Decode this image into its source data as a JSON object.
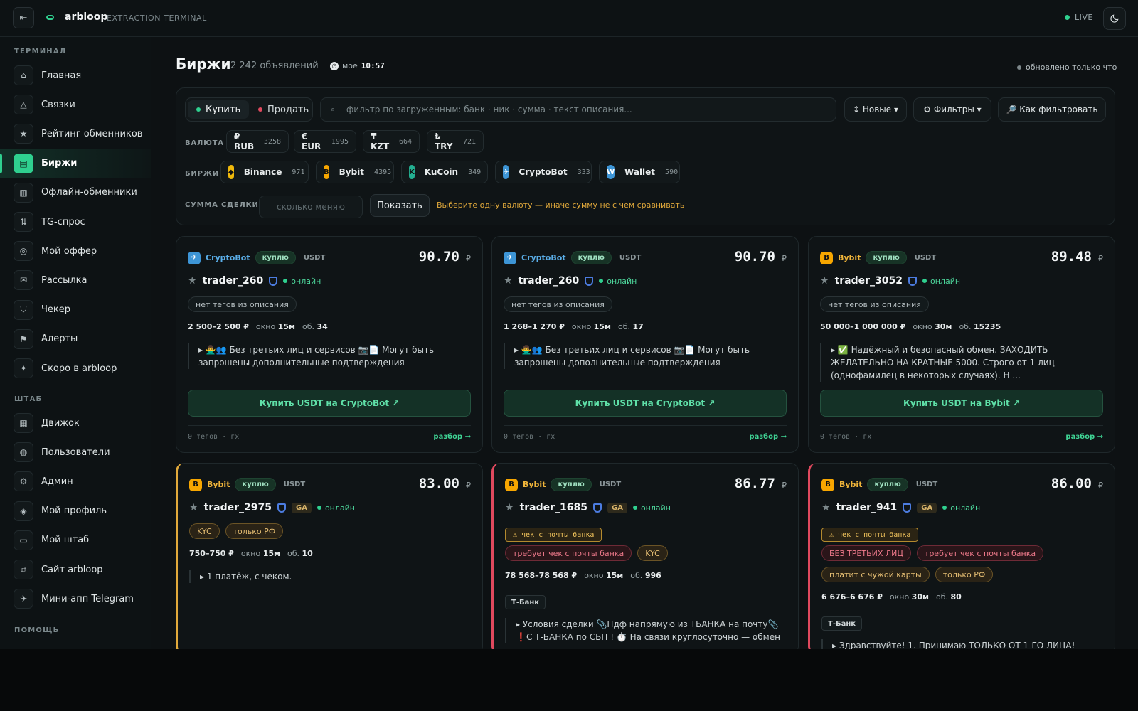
{
  "topbar": {
    "brand_name": "arbloop",
    "brand_sub": "EXTRACTION TERMINAL",
    "live": "LIVE"
  },
  "sidebar": {
    "section_terminal": "ТЕРМИНАЛ",
    "section_staff": "ШТАБ",
    "section_help": "ПОМОЩЬ",
    "terminal_items": [
      {
        "label": "Главная",
        "icon": "⌂"
      },
      {
        "label": "Связки",
        "icon": "△"
      },
      {
        "label": "Рейтинг обменников",
        "icon": "★"
      },
      {
        "label": "Биржи",
        "icon": "▤"
      },
      {
        "label": "Офлайн-обменники",
        "icon": "▥"
      },
      {
        "label": "TG-спрос",
        "icon": "⇅"
      },
      {
        "label": "Мой оффер",
        "icon": "◎"
      },
      {
        "label": "Рассылка",
        "icon": "✉"
      },
      {
        "label": "Чекер",
        "icon": "⛉"
      },
      {
        "label": "Алерты",
        "icon": "⚑"
      },
      {
        "label": "Скоро в arbloop",
        "icon": "✦"
      }
    ],
    "staff_items": [
      {
        "label": "Движок",
        "icon": "▦"
      },
      {
        "label": "Пользователи",
        "icon": "◍"
      },
      {
        "label": "Админ",
        "icon": "⚙"
      },
      {
        "label": "Мой профиль",
        "icon": "◈"
      },
      {
        "label": "Мой штаб",
        "icon": "▭"
      },
      {
        "label": "Сайт arbloop",
        "icon": "⧉"
      },
      {
        "label": "Мини-апп Telegram",
        "icon": "✈"
      }
    ]
  },
  "header": {
    "title": "Биржи",
    "count": "2 242 объявлений",
    "clock_label": "моё",
    "clock_time": "10:57",
    "updated": "обновлено только что"
  },
  "filters": {
    "buy": "Купить",
    "sell": "Продать",
    "search_placeholder": "фильтр по загруженным: банк · ник · сумма · текст описания...",
    "sort": "↕ Новые ▾",
    "filters_btn": "⚙ Фильтры ▾",
    "howto": "🔎 Как фильтровать",
    "currency_label": "ВАЛЮТА",
    "currencies": [
      {
        "label": "₽ RUB",
        "count": "3258"
      },
      {
        "label": "€ EUR",
        "count": "1995"
      },
      {
        "label": "₸ KZT",
        "count": "664"
      },
      {
        "label": "₺ TRY",
        "count": "721"
      }
    ],
    "exchanges_label": "БИРЖИ",
    "exchanges": [
      {
        "label": "Binance",
        "count": "971",
        "logo": "◆",
        "color": "#f0b90b"
      },
      {
        "label": "Bybit",
        "count": "4395",
        "logo": "B",
        "color": "#f7a600"
      },
      {
        "label": "KuCoin",
        "count": "349",
        "logo": "K",
        "color": "#23af91"
      },
      {
        "label": "CryptoBot",
        "count": "333",
        "logo": "✈",
        "color": "#3d95d6"
      },
      {
        "label": "Wallet",
        "count": "590",
        "logo": "W",
        "color": "#3d95d6"
      }
    ],
    "amount_label": "СУММА СДЕЛКИ",
    "amount_placeholder": "сколько меняю",
    "show": "Показать",
    "warning": "Выберите одну валюту — иначе сумму не с чем сравнивать"
  },
  "cards": [
    {
      "exchange": "CryptoBot",
      "logo": "✈",
      "ex_color": "#3d95d6",
      "side": "куплю",
      "asset": "USDT",
      "price": "90.70",
      "currency": "₽",
      "trader": "trader_260",
      "online": "онлайн",
      "tag": "нет тегов из описания",
      "range": "2 500–2 500 ₽",
      "window_label": "окно",
      "window": "15м",
      "deals_label": "об.",
      "deals": "34",
      "desc": "▸ 🙅‍♂️👥 Без третьих лиц и сервисов 📷📄 Могут быть запрошены дополнительные подтверждения",
      "cta": "Купить USDT на CryptoBot ↗",
      "foot": "0 тегов · гх",
      "analysis": "разбор →"
    },
    {
      "exchange": "CryptoBot",
      "logo": "✈",
      "ex_color": "#3d95d6",
      "side": "куплю",
      "asset": "USDT",
      "price": "90.70",
      "currency": "₽",
      "trader": "trader_260",
      "online": "онлайн",
      "tag": "нет тегов из описания",
      "range": "1 268–1 270 ₽",
      "window_label": "окно",
      "window": "15м",
      "deals_label": "об.",
      "deals": "17",
      "desc": "▸ 🙅‍♂️👥 Без третьих лиц и сервисов 📷📄 Могут быть запрошены дополнительные подтверждения",
      "cta": "Купить USDT на CryptoBot ↗",
      "foot": "0 тегов · гх",
      "analysis": "разбор →"
    },
    {
      "exchange": "Bybit",
      "logo": "B",
      "ex_color": "#f7a600",
      "side": "куплю",
      "asset": "USDT",
      "price": "89.48",
      "currency": "₽",
      "trader": "trader_3052",
      "online": "онлайн",
      "tag": "нет тегов из описания",
      "range": "50 000–1 000 000 ₽",
      "window_label": "окно",
      "window": "30м",
      "deals_label": "об.",
      "deals": "15235",
      "desc": "▸ ✅ Надёжный и безопасный обмен. ЗАХОДИТЬ ЖЕЛАТЕЛЬНО НА КРАТНЫЕ 5000. Строго от 1 лиц (однофамилец в некоторых случаях). Н ...",
      "cta": "Купить USDT на Bybit ↗",
      "foot": "0 тегов · гх",
      "analysis": "разбор →"
    },
    {
      "exchange": "Bybit",
      "logo": "B",
      "ex_color": "#f7a600",
      "side": "куплю",
      "asset": "USDT",
      "price": "83.00",
      "currency": "₽",
      "trader": "trader_2975",
      "ga": "GA",
      "online": "онлайн",
      "tags": [
        "KYC",
        "только РФ"
      ],
      "range": "750–750 ₽",
      "window_label": "окно",
      "window": "15м",
      "deals_label": "об.",
      "deals": "10",
      "desc": "▸ 1 платёж, с чеком."
    },
    {
      "exchange": "Bybit",
      "logo": "B",
      "ex_color": "#f7a600",
      "side": "куплю",
      "asset": "USDT",
      "price": "86.77",
      "currency": "₽",
      "trader": "trader_1685",
      "ga": "GA",
      "online": "онлайн",
      "alert": "⚠ чек с почты банка",
      "tags": [
        "требует чек с почты банка",
        "KYC"
      ],
      "range": "78 568–78 568 ₽",
      "window_label": "окно",
      "window": "15м",
      "deals_label": "об.",
      "deals": "996",
      "bank": "Т-Банк",
      "desc": "▸ Условия сделки 📎Пдф напрямую из ТБАНКА на почту📎 ❗С Т-БАНКА по СБП ! ⏱️ На связи круглосуточно — обмен"
    },
    {
      "exchange": "Bybit",
      "logo": "B",
      "ex_color": "#f7a600",
      "side": "куплю",
      "asset": "USDT",
      "price": "86.00",
      "currency": "₽",
      "trader": "trader_941",
      "ga": "GA",
      "online": "онлайн",
      "alert": "⚠ чек с почты банка",
      "tags": [
        "БЕЗ ТРЕТЬИХ ЛИЦ",
        "требует чек с почты банка",
        "платит с чужой карты",
        "только РФ"
      ],
      "range": "6 676–6 676 ₽",
      "window_label": "окно",
      "window": "30м",
      "deals_label": "об.",
      "deals": "80",
      "bank": "Т-Банк",
      "desc": "▸ Здравствуйте! 1. Принимаю ТОЛЬКО ОТ 1-ГО ЛИЦА!"
    }
  ]
}
